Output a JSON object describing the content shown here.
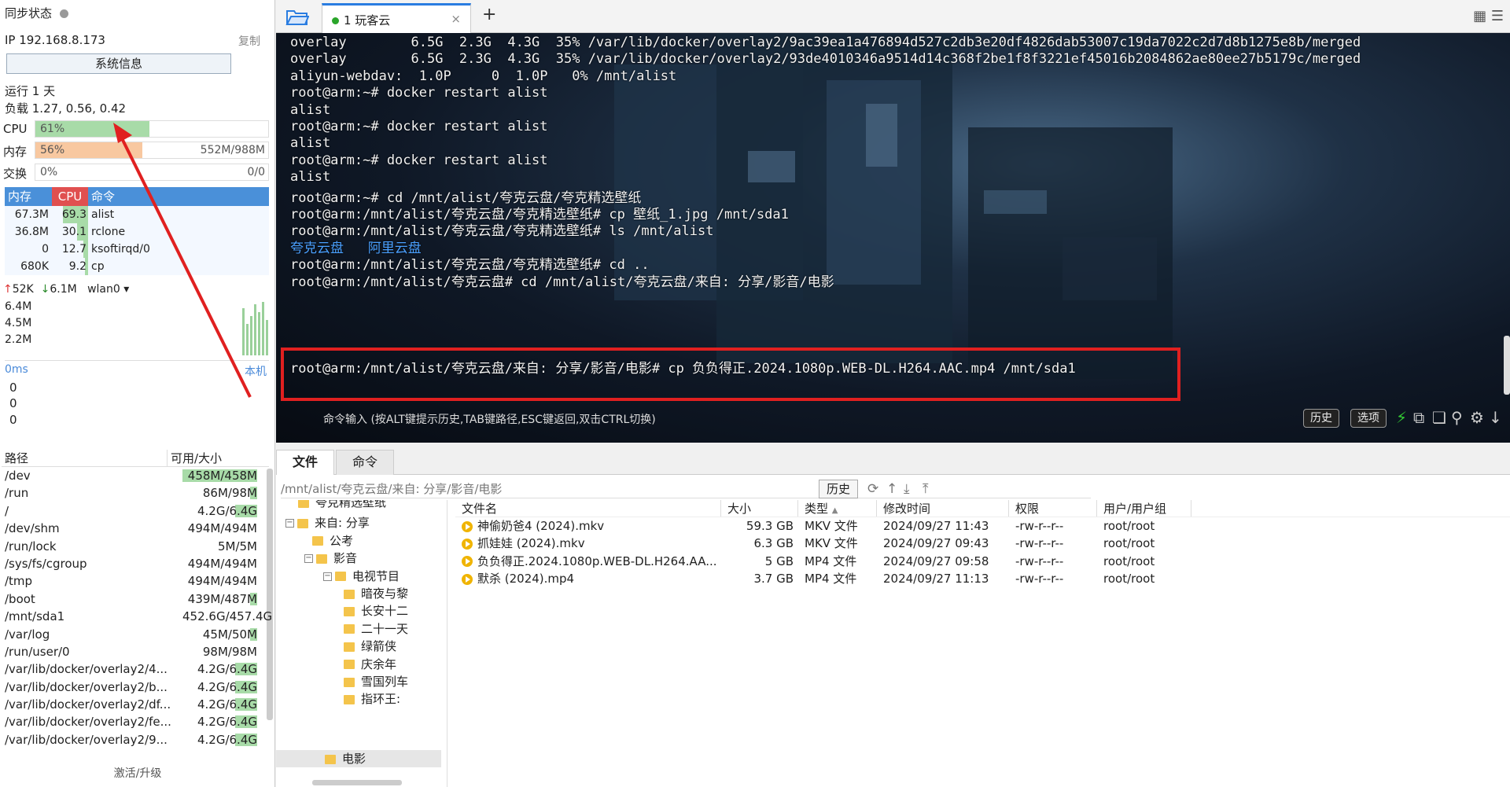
{
  "left": {
    "sync_status": "同步状态",
    "ip": "IP 192.168.8.173",
    "copy": "复制",
    "sysinfo_button": "系统信息",
    "uptime": "运行 1 天",
    "load": "负载 1.27, 0.56, 0.42",
    "cpu": {
      "label": "CPU",
      "percent_text": "61%",
      "fraction": 0.49
    },
    "mem": {
      "label": "内存",
      "percent_text": "56%",
      "usage": "552M/988M",
      "fraction": 0.46
    },
    "swap": {
      "label": "交换",
      "percent_text": "0%",
      "usage": "0/0",
      "fraction": 0
    },
    "proc_headers": {
      "mem": "内存",
      "cpu": "CPU",
      "cmd": "命令"
    },
    "processes": [
      {
        "mem": "67.3M",
        "cpu": "69.3",
        "cmd": "alist"
      },
      {
        "mem": "36.8M",
        "cpu": "30.1",
        "cmd": "rclone"
      },
      {
        "mem": "0",
        "cpu": "12.7",
        "cmd": "ksoftirqd/0"
      },
      {
        "mem": "680K",
        "cpu": "9.2",
        "cmd": "cp"
      }
    ],
    "net": {
      "up": "52K",
      "down": "6.1M",
      "iface": "wlan0"
    },
    "net_scale": [
      "6.4M",
      "4.5M",
      "2.2M"
    ],
    "ping": "0ms",
    "local": "本机",
    "ping_values": [
      "0",
      "0",
      "0"
    ],
    "disk_headers": {
      "path": "路径",
      "size": "可用/大小"
    },
    "disks": [
      {
        "path": "/dev",
        "size": "458M/458M",
        "fill": 1.0
      },
      {
        "path": "/run",
        "size": "86M/98M",
        "fill": 0.1
      },
      {
        "path": "/",
        "size": "4.2G/6.4G",
        "fill": 0.3
      },
      {
        "path": "/dev/shm",
        "size": "494M/494M",
        "fill": 0
      },
      {
        "path": "/run/lock",
        "size": "5M/5M",
        "fill": 0
      },
      {
        "path": "/sys/fs/cgroup",
        "size": "494M/494M",
        "fill": 0
      },
      {
        "path": "/tmp",
        "size": "494M/494M",
        "fill": 0
      },
      {
        "path": "/boot",
        "size": "439M/487M",
        "fill": 0.1
      },
      {
        "path": "/mnt/sda1",
        "size": "452.6G/457.4G",
        "fill": 0
      },
      {
        "path": "/var/log",
        "size": "45M/50M",
        "fill": 0.1
      },
      {
        "path": "/run/user/0",
        "size": "98M/98M",
        "fill": 0
      },
      {
        "path": "/var/lib/docker/overlay2/4...",
        "size": "4.2G/6.4G",
        "fill": 0.3
      },
      {
        "path": "/var/lib/docker/overlay2/b...",
        "size": "4.2G/6.4G",
        "fill": 0.3
      },
      {
        "path": "/var/lib/docker/overlay2/df...",
        "size": "4.2G/6.4G",
        "fill": 0.3
      },
      {
        "path": "/var/lib/docker/overlay2/fe...",
        "size": "4.2G/6.4G",
        "fill": 0.3
      },
      {
        "path": "/var/lib/docker/overlay2/9...",
        "size": "4.2G/6.4G",
        "fill": 0.3
      }
    ],
    "upgrade": "激活/升级"
  },
  "tabbar": {
    "tab_label": "1 玩客云",
    "close": "×",
    "add": "+"
  },
  "terminal": {
    "lines": [
      "overlay        6.5G  2.3G  4.3G  35% /var/lib/docker/overlay2/9ac39ea1a476894d527c2db3e20df4826dab53007c19da7022c2d7d8b1275e8b/merged",
      "overlay        6.5G  2.3G  4.3G  35% /var/lib/docker/overlay2/93de4010346a9514d14c368f2be1f8f3221ef45016b2084862ae80ee27b5179c/merged",
      "aliyun-webdav:  1.0P     0  1.0P   0% /mnt/alist",
      "root@arm:~# docker restart alist",
      "alist",
      "root@arm:~# docker restart alist",
      "alist",
      "root@arm:~# docker restart alist",
      "alist",
      "root@arm:~# cd /mnt/alist/夸克云盘/夸克精选壁纸",
      "root@arm:/mnt/alist/夸克云盘/夸克精选壁纸# cp 壁纸_1.jpg /mnt/sda1",
      "root@arm:/mnt/alist/夸克云盘/夸克精选壁纸# ls /mnt/alist",
      "夸克云盘   阿里云盘",
      "root@arm:/mnt/alist/夸克云盘/夸克精选壁纸# cd ..",
      "root@arm:/mnt/alist/夸克云盘# cd /mnt/alist/夸克云盘/来自: 分享/影音/电影",
      "root@arm:/mnt/alist/夸克云盘/来自: 分享/影音/电影# cp 负负得正.2024.1080p.WEB-DL.H264.AAC.mp4 /mnt/sda1"
    ],
    "hint": "命令输入 (按ALT键提示历史,TAB键路径,ESC键返回,双击CTRL切换)",
    "history_btn": "历史",
    "options_btn": "选项"
  },
  "bottom": {
    "tab_files": "文件",
    "tab_commands": "命令",
    "path": "/mnt/alist/夸克云盘/来自: 分享/影音/电影",
    "history_btn": "历史",
    "tree": [
      {
        "label": "夸克精选壁纸"
      },
      {
        "label": "来自: 分享"
      },
      {
        "label": "公考"
      },
      {
        "label": "影音"
      },
      {
        "label": "电视节目"
      },
      {
        "label": "暗夜与黎"
      },
      {
        "label": "长安十二"
      },
      {
        "label": "二十一天"
      },
      {
        "label": "绿箭侠"
      },
      {
        "label": "庆余年"
      },
      {
        "label": "雪国列车"
      },
      {
        "label": "指环王: "
      },
      {
        "label": "电影"
      }
    ],
    "file_headers": {
      "name": "文件名",
      "size": "大小",
      "type": "类型",
      "mtime": "修改时间",
      "perm": "权限",
      "owner": "用户/用户组"
    },
    "files": [
      {
        "name": "神偷奶爸4 (2024).mkv",
        "size": "59.3 GB",
        "type": "MKV 文件",
        "mtime": "2024/09/27 11:43",
        "perm": "-rw-r--r--",
        "owner": "root/root"
      },
      {
        "name": "抓娃娃 (2024).mkv",
        "size": "6.3 GB",
        "type": "MKV 文件",
        "mtime": "2024/09/27 09:43",
        "perm": "-rw-r--r--",
        "owner": "root/root"
      },
      {
        "name": "负负得正.2024.1080p.WEB-DL.H264.AA...",
        "size": "5 GB",
        "type": "MP4 文件",
        "mtime": "2024/09/27 09:58",
        "perm": "-rw-r--r--",
        "owner": "root/root"
      },
      {
        "name": "默杀 (2024).mp4",
        "size": "3.7 GB",
        "type": "MP4 文件",
        "mtime": "2024/09/27 11:13",
        "perm": "-rw-r--r--",
        "owner": "root/root"
      }
    ]
  },
  "colors": {
    "accent": "#2a7de1",
    "cpu_fill": "#a8dba8",
    "mem_fill": "#f8c8a0",
    "highlight": "#e02020",
    "folder": "#f4c44b"
  }
}
